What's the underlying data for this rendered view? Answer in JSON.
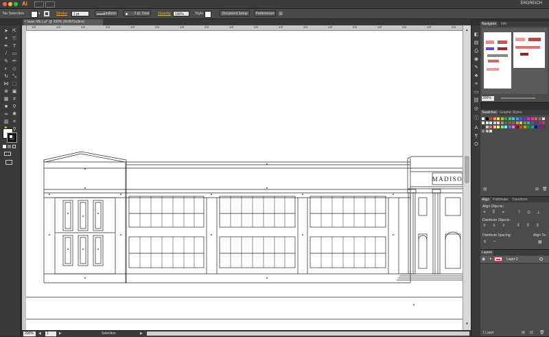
{
  "menubar": {
    "app_logo": "Ai",
    "workspace": "ERDREICH"
  },
  "controlbar": {
    "selection_status": "No Selection",
    "stroke_label": "Stroke",
    "stroke_weight": "1 pt",
    "profile": "Uniform",
    "brush": "2 pt. Oval",
    "opacity_label": "Opacity",
    "opacity_value": "100%",
    "style_label": "Style",
    "document_setup": "Document Setup",
    "preferences": "Preferences"
  },
  "document_tab": {
    "title": "laser ME.Lai* @ 200% (RGB/Outline)",
    "close": "×"
  },
  "ruler_labels": [
    "1/2",
    "1/2",
    "1/2",
    "1/2",
    "1/2",
    "1/2",
    "1/2",
    "1/2",
    "1/2",
    "1/2",
    "1/2",
    "1/2",
    "1/2",
    "1/2",
    "1/2",
    "1/2",
    "1/2",
    "1/2"
  ],
  "navigator": {
    "tabs": [
      "Navigator",
      "Info"
    ],
    "zoom": "200%"
  },
  "swatches": {
    "tabs": [
      "Swatches",
      "Graphic Styles"
    ]
  },
  "align": {
    "tabs": [
      "Align",
      "Pathfinder",
      "Transform"
    ],
    "align_objects": "Align Objects:",
    "distribute_objects": "Distribute Objects:",
    "distribute_spacing": "Distribute Spacing:",
    "align_to": "Align To:"
  },
  "layers": {
    "tabs": [
      "Layers"
    ],
    "layer_name": "Layer 2",
    "footer": "1 Layer"
  },
  "canvas": {
    "sign_text": "MADISO"
  },
  "statusbar": {
    "zoom": "200%",
    "page": "1",
    "mode": "Selection"
  },
  "colors": {
    "accent": "#f0a64a",
    "panel_bg": "#4b4b4b",
    "app_bg": "#2f2f2f"
  }
}
